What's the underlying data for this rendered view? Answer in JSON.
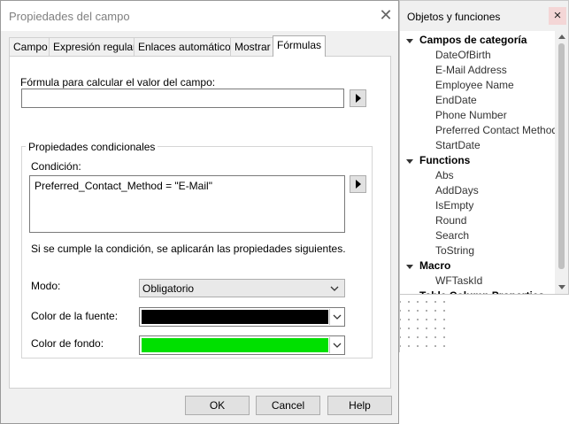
{
  "dialog": {
    "title": "Propiedades del campo",
    "tabs": [
      "Campo",
      "Expresión regular",
      "Enlaces automáticos",
      "Mostrar",
      "Fórmulas"
    ],
    "active_tab": "Fórmulas",
    "formula_label": "Fórmula para calcular el valor del campo:",
    "formula_value": "",
    "group_title": "Propiedades condicionales",
    "condition_label": "Condición:",
    "condition_value": "Preferred_Contact_Method = \"E-Mail\"",
    "note": "Si se cumple la condición, se aplicarán las propiedades siguientes.",
    "mode_label": "Modo:",
    "mode_value": "Obligatorio",
    "font_color_label": "Color de la fuente:",
    "font_color": "#000000",
    "bg_color_label": "Color de fondo:",
    "bg_color": "#00e000",
    "buttons": {
      "ok": "OK",
      "cancel": "Cancel",
      "help": "Help"
    }
  },
  "panel": {
    "title": "Objetos y funciones",
    "close": "×",
    "groups": [
      {
        "name": "Campos de categoría",
        "items": [
          "DateOfBirth",
          "E-Mail Address",
          "Employee Name",
          "EndDate",
          "Phone Number",
          "Preferred Contact Method",
          "StartDate"
        ]
      },
      {
        "name": "Functions",
        "items": [
          "Abs",
          "AddDays",
          "IsEmpty",
          "Round",
          "Search",
          "ToString"
        ]
      },
      {
        "name": "Macro",
        "items": [
          "WFTaskId"
        ]
      },
      {
        "name": "Table Column Properties",
        "items": []
      }
    ]
  }
}
